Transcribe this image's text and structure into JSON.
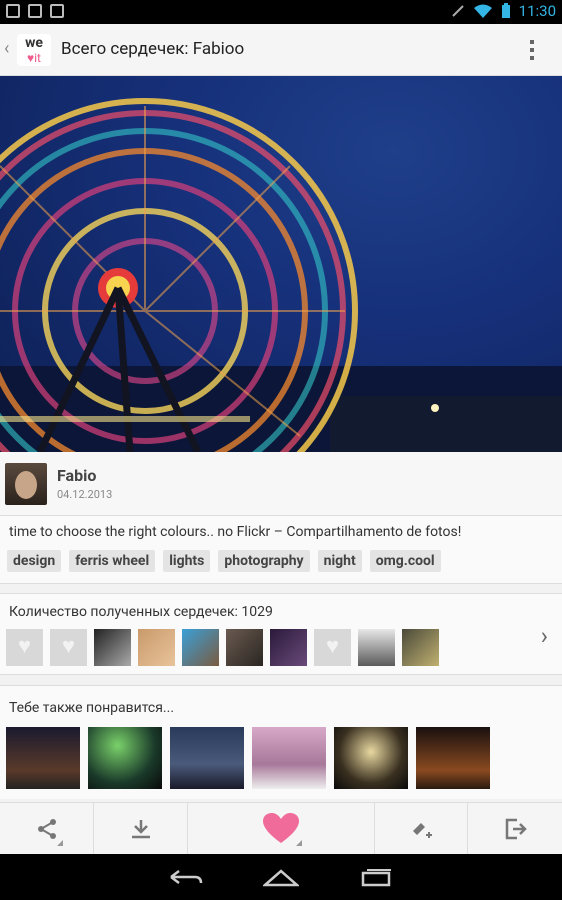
{
  "status_bar": {
    "time": "11:30"
  },
  "app": {
    "logo_text": "we",
    "logo_heart": "♥it",
    "title": "Всего сердечек: Fabioo"
  },
  "author": {
    "name": "Fabio",
    "date": "04.12.2013"
  },
  "post": {
    "description": "time to choose the right colours.. no Flickr – Compartilhamento de fotos!",
    "tags": [
      "design",
      "ferris wheel",
      "lights",
      "photography",
      "night",
      "omg.cool"
    ]
  },
  "hearts": {
    "title": "Количество полученных сердечек: 1029"
  },
  "also_like": {
    "title": "Тебе также понравится..."
  },
  "icons": {
    "share": "share-icon",
    "download": "download-icon",
    "heart": "heart-icon",
    "collect": "collect-icon",
    "exit": "exit-icon"
  },
  "colors": {
    "accent": "#f05a8c",
    "status_accent": "#33b5e5"
  }
}
